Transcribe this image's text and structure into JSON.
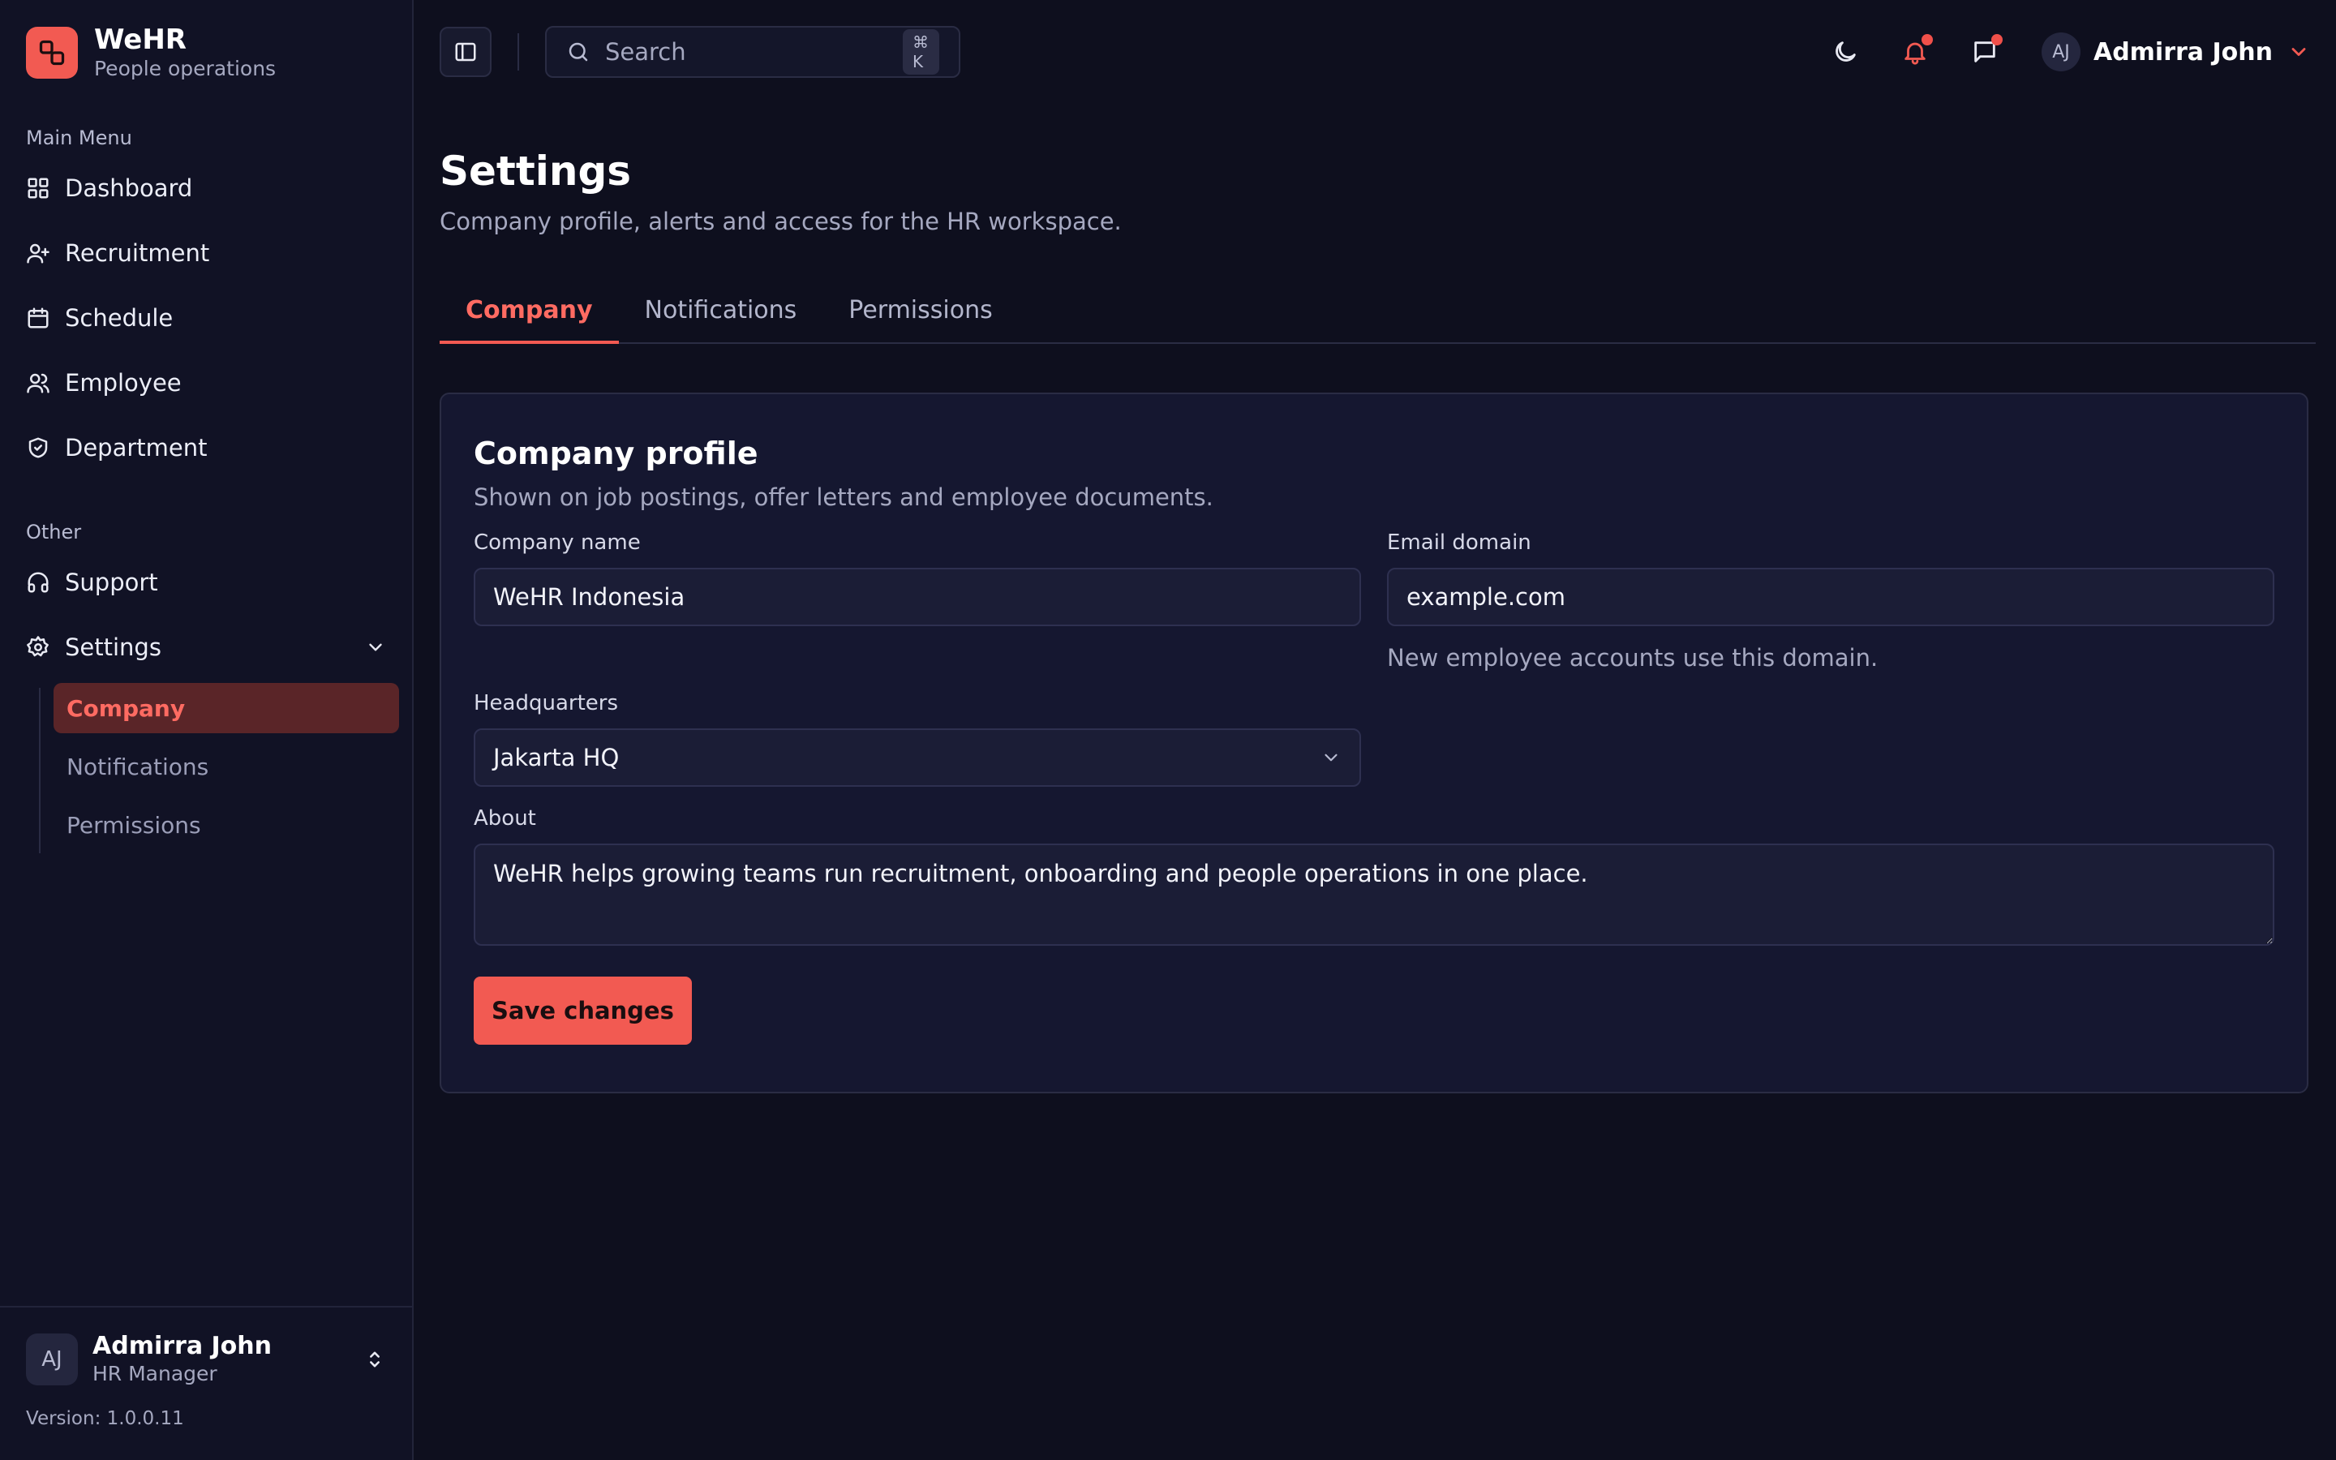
{
  "brand": {
    "name": "WeHR",
    "tagline": "People operations"
  },
  "sidebar": {
    "main_menu_label": "Main Menu",
    "main_items": [
      {
        "label": "Dashboard",
        "icon": "dashboard-grid-icon"
      },
      {
        "label": "Recruitment",
        "icon": "user-plus-icon"
      },
      {
        "label": "Schedule",
        "icon": "calendar-icon"
      },
      {
        "label": "Employee",
        "icon": "users-icon"
      },
      {
        "label": "Department",
        "icon": "shield-icon"
      }
    ],
    "other_label": "Other",
    "other_items": [
      {
        "label": "Support",
        "icon": "headphones-icon"
      },
      {
        "label": "Settings",
        "icon": "gear-icon",
        "expanded": true
      }
    ],
    "settings_sub": [
      {
        "label": "Company",
        "active": true
      },
      {
        "label": "Notifications",
        "active": false
      },
      {
        "label": "Permissions",
        "active": false
      }
    ],
    "footer": {
      "avatar_initials": "AJ",
      "user_name": "Admirra John",
      "user_role": "HR Manager",
      "version": "Version: 1.0.0.11"
    }
  },
  "topbar": {
    "search_placeholder": "Search",
    "search_shortcut": "⌘ K",
    "user": {
      "initials": "AJ",
      "name": "Admirra John"
    },
    "icons": [
      "sidebar-toggle-icon",
      "moon-icon",
      "bell-icon",
      "chat-icon"
    ]
  },
  "page": {
    "title": "Settings",
    "subtitle": "Company profile, alerts and access for the HR workspace.",
    "tabs": [
      {
        "label": "Company",
        "active": true
      },
      {
        "label": "Notifications",
        "active": false
      },
      {
        "label": "Permissions",
        "active": false
      }
    ]
  },
  "form": {
    "title": "Company profile",
    "subtitle": "Shown on job postings, offer letters and employee documents.",
    "company_name": {
      "label": "Company name",
      "value": "WeHR Indonesia"
    },
    "email_domain": {
      "label": "Email domain",
      "value": "example.com",
      "hint": "New employee accounts use this domain."
    },
    "headquarters": {
      "label": "Headquarters",
      "value": "Jakarta HQ"
    },
    "about": {
      "label": "About",
      "value": "WeHR helps growing teams run recruitment, onboarding and people operations in one place."
    },
    "save_label": "Save changes"
  },
  "colors": {
    "accent": "#f25a52",
    "background": "#0e0f1e",
    "sidebar": "#111225",
    "card": "#151730"
  }
}
